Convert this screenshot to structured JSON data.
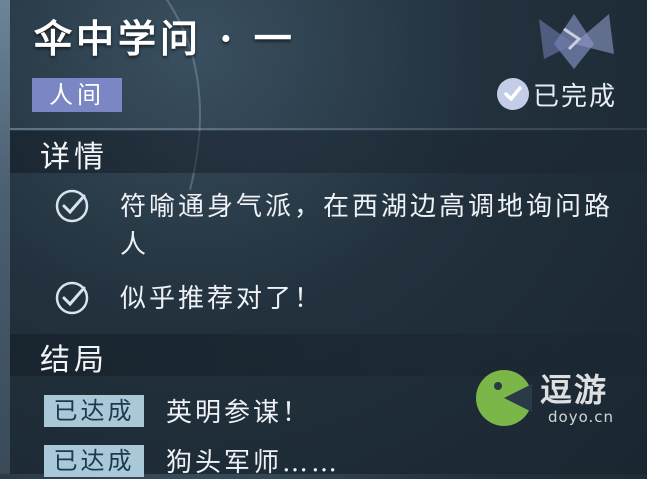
{
  "quest": {
    "title": "伞中学问 · 一",
    "category_tag": "人间",
    "status_label": "已完成"
  },
  "details": {
    "heading": "详情",
    "items": [
      {
        "text": "符喻通身气派，在西湖边高调地询问路人",
        "checked": true
      },
      {
        "text": "似乎推荐对了！",
        "checked": true
      }
    ]
  },
  "endings": {
    "heading": "结局",
    "items": [
      {
        "badge": "已达成",
        "text": "英明参谋！"
      },
      {
        "badge": "已达成",
        "text": "狗头军师……"
      }
    ]
  },
  "watermark": {
    "name": "逗游",
    "domain": "doyo.cn"
  },
  "colors": {
    "tag_bg": "#7b87c4",
    "badge_bg": "#a9c8d8",
    "check_circle": "#c4cde8"
  }
}
